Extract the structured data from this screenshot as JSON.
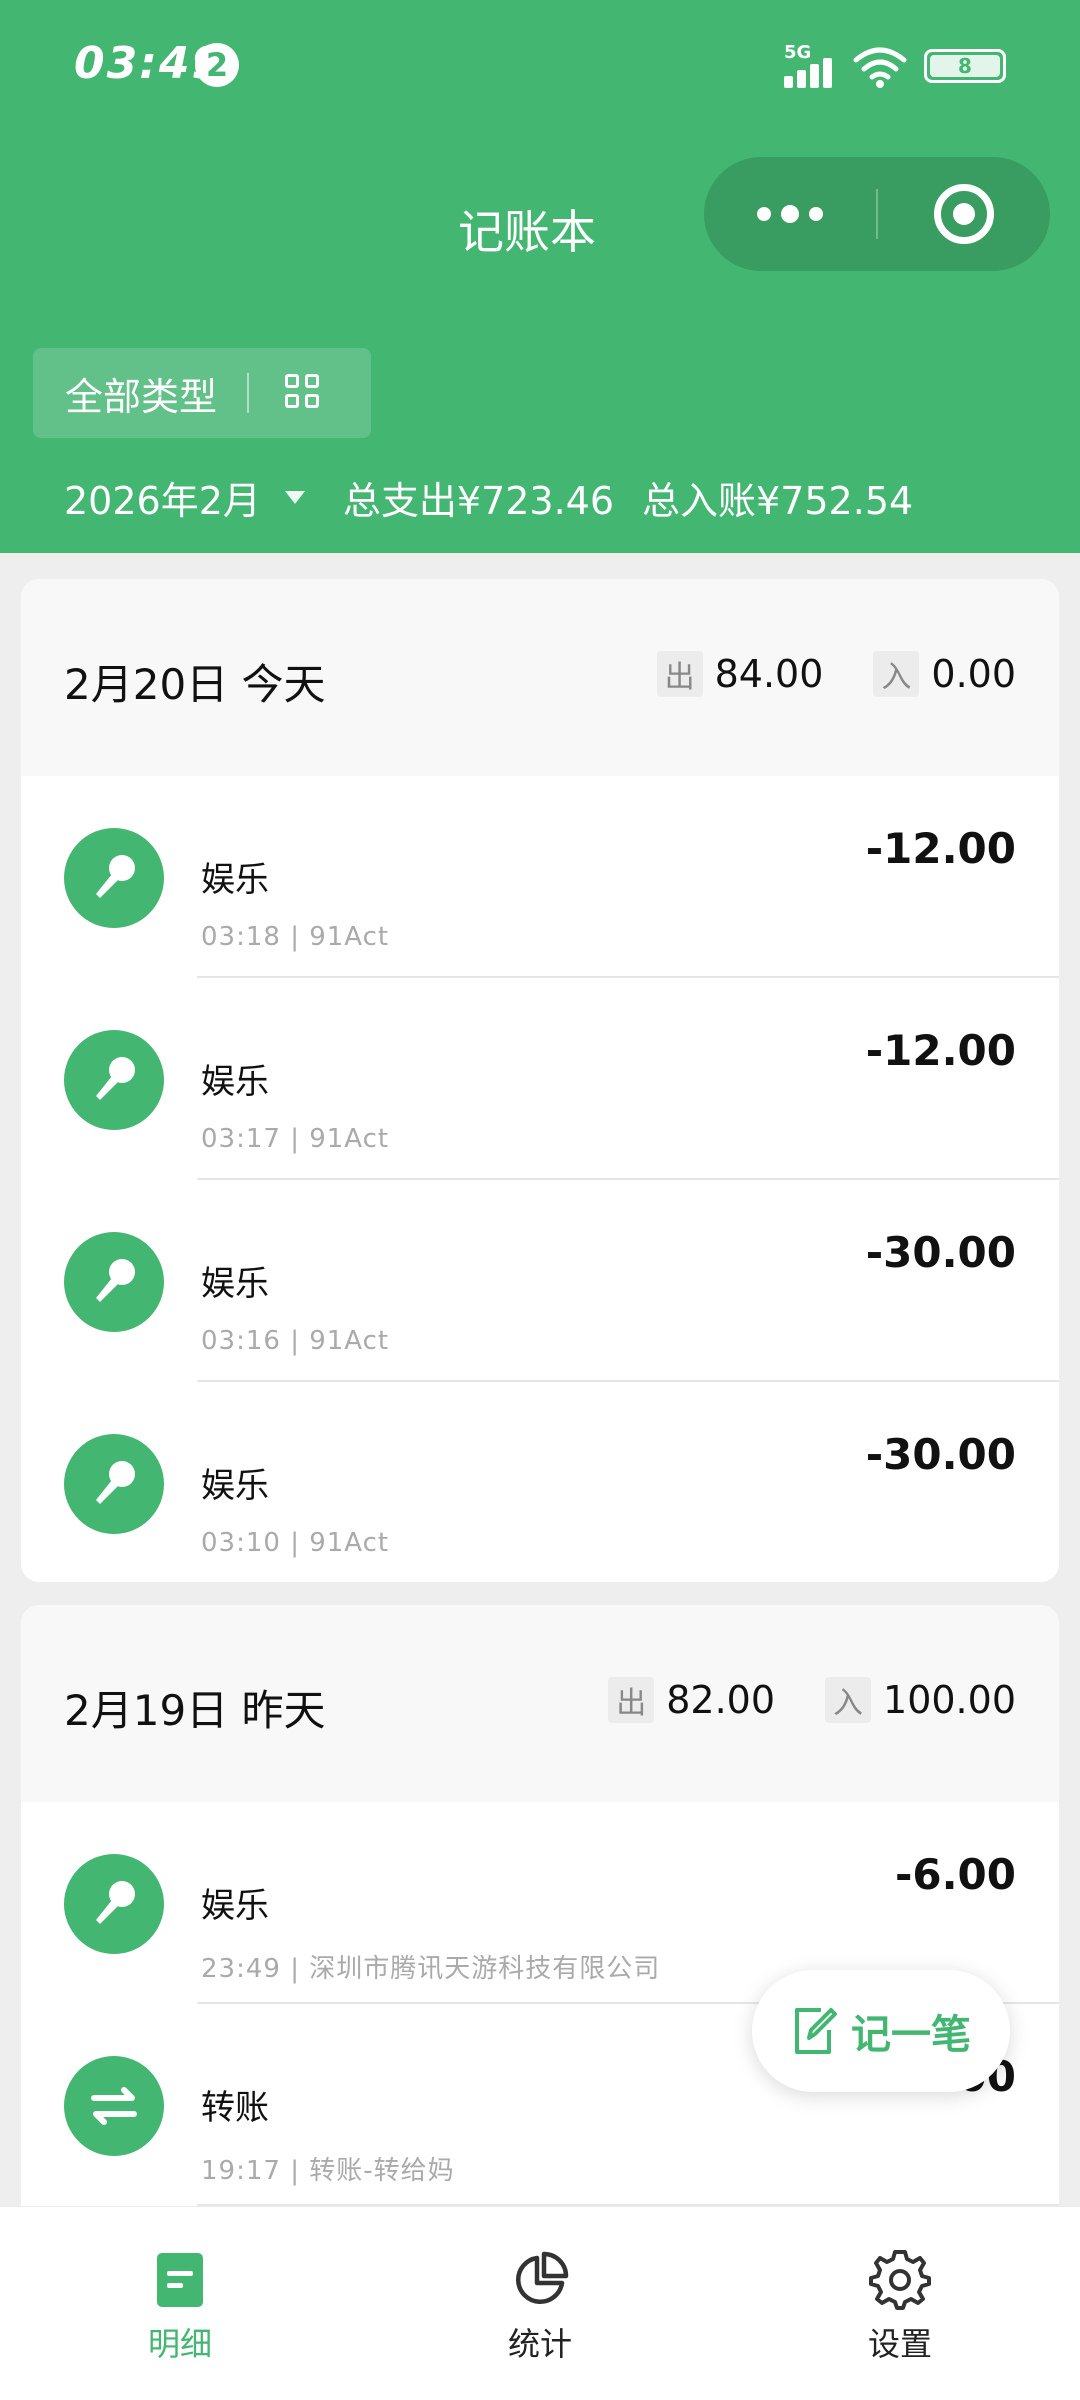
{
  "status_bar": {
    "time": "03:49",
    "notification_count": "2",
    "network": "5G",
    "battery": "8"
  },
  "header": {
    "title": "记账本",
    "type_filter_label": "全部类型",
    "month": "2026年2月",
    "total_expense": "总支出¥723.46",
    "total_income": "总入账¥752.54"
  },
  "labels": {
    "out": "出",
    "in": "入"
  },
  "days": [
    {
      "label": "2月20日 今天",
      "out": "84.00",
      "in": "0.00",
      "entries": [
        {
          "category": "娱乐",
          "meta": "03:18 | 91Act",
          "amount": "-12.00",
          "icon": "microphone-icon"
        },
        {
          "category": "娱乐",
          "meta": "03:17 | 91Act",
          "amount": "-12.00",
          "icon": "microphone-icon"
        },
        {
          "category": "娱乐",
          "meta": "03:16 | 91Act",
          "amount": "-30.00",
          "icon": "microphone-icon"
        },
        {
          "category": "娱乐",
          "meta": "03:10 | 91Act",
          "amount": "-30.00",
          "icon": "microphone-icon"
        }
      ]
    },
    {
      "label": "2月19日 昨天",
      "out": "82.00",
      "in": "100.00",
      "entries": [
        {
          "category": "娱乐",
          "meta": "23:49 | 深圳市腾讯天游科技有限公司",
          "amount": "-6.00",
          "icon": "microphone-icon"
        },
        {
          "category": "转账",
          "meta": "19:17 | 转账-转给妈",
          "amount": "-50.00",
          "icon": "transfer-arrows-icon"
        }
      ]
    }
  ],
  "fab": {
    "label": "记一笔",
    "icon": "edit-note-icon"
  },
  "tabbar": {
    "tabs": [
      {
        "label": "明细",
        "icon": "document-icon",
        "active": true
      },
      {
        "label": "统计",
        "icon": "pie-chart-icon",
        "active": false
      },
      {
        "label": "设置",
        "icon": "gear-icon",
        "active": false
      }
    ]
  },
  "colors": {
    "primary": "#43b672",
    "background": "#eeeeee",
    "card": "#ffffff",
    "day_header": "#f8f8f8"
  }
}
